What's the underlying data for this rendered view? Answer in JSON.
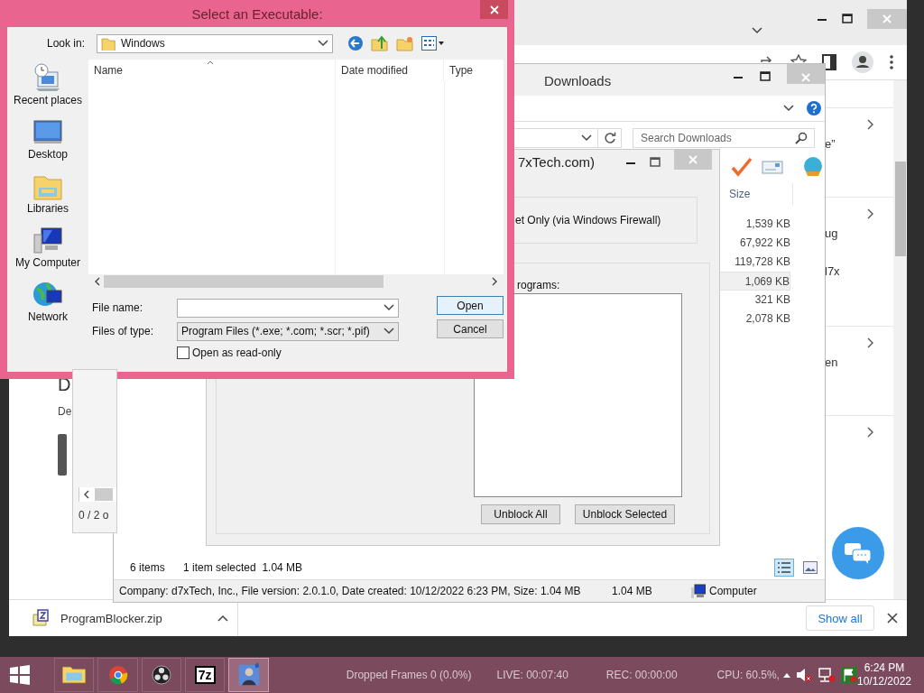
{
  "browser": {
    "page_left": {
      "heading": "D",
      "text": "De",
      "pager": "0 / 2 o"
    },
    "page_right": [
      {
        "expandable": true,
        "lines": [
          "e”"
        ]
      },
      {
        "expandable": true,
        "lines": [
          "ug",
          "l7x"
        ]
      },
      {
        "expandable": true,
        "lines": [
          "en"
        ]
      },
      {
        "expandable": true
      }
    ],
    "download": {
      "file": "ProgramBlocker.zip",
      "action": "Show all"
    }
  },
  "explorer": {
    "title": "Downloads",
    "search": {
      "placeholder": "Search Downloads"
    },
    "size_header": "Size",
    "sizes": [
      {
        "value": "1,539 KB",
        "selected": false
      },
      {
        "value": "67,922 KB",
        "selected": false
      },
      {
        "value": "119,728 KB",
        "selected": false
      },
      {
        "value": "1,069 KB",
        "selected": true
      },
      {
        "value": "321 KB",
        "selected": false
      },
      {
        "value": "2,078 KB",
        "selected": false
      }
    ],
    "item_count": "6 items",
    "selection": "1 item selected  1.04 MB",
    "details": "Company: d7xTech, Inc., File version: 2.0.1.0, Date created: 10/12/2022 6:23 PM, Size: 1.04 MB",
    "details_size": "1.04 MB",
    "location": "Computer"
  },
  "blocker": {
    "title": "7xTech.com)",
    "mode_label": "et Only (via Windows Firewall)",
    "list_label": "rograms:",
    "buttons": [
      "Unblock All",
      "Unblock Selected"
    ]
  },
  "dialog": {
    "title": "Select an Executable:",
    "look_in": {
      "label": "Look in:",
      "value": "Windows"
    },
    "places": [
      {
        "label": "Recent places",
        "kind": "recent"
      },
      {
        "label": "Desktop",
        "kind": "desktop"
      },
      {
        "label": "Libraries",
        "kind": "libraries"
      },
      {
        "label": "My Computer",
        "kind": "computer"
      },
      {
        "label": "Network",
        "kind": "network"
      }
    ],
    "columns": [
      "Name",
      "Date modified",
      "Type"
    ],
    "file_name": {
      "label": "File name:"
    },
    "file_type": {
      "label": "Files of type:",
      "value": "Program Files (*.exe; *.com; *.scr; *.pif)"
    },
    "read_only": {
      "label": "Open as read-only",
      "checked": false
    },
    "buttons": [
      {
        "label": "Open",
        "default": true
      },
      {
        "label": "Cancel",
        "default": false
      }
    ]
  },
  "taskbar": {
    "apps": [
      {
        "kind": "folder",
        "active": false
      },
      {
        "kind": "browser",
        "active": false
      },
      {
        "kind": "recorder",
        "active": false
      },
      {
        "kind": "archive",
        "text": "7z",
        "active": false
      },
      {
        "kind": "avatar",
        "active": true
      }
    ],
    "obs_stats": [
      "Dropped Frames 0 (0.0%)",
      "LIVE: 00:07:40",
      "REC: 00:00:00",
      "CPU: 60.5%,"
    ],
    "time": "6:24 PM",
    "date": "10/12/2022"
  }
}
